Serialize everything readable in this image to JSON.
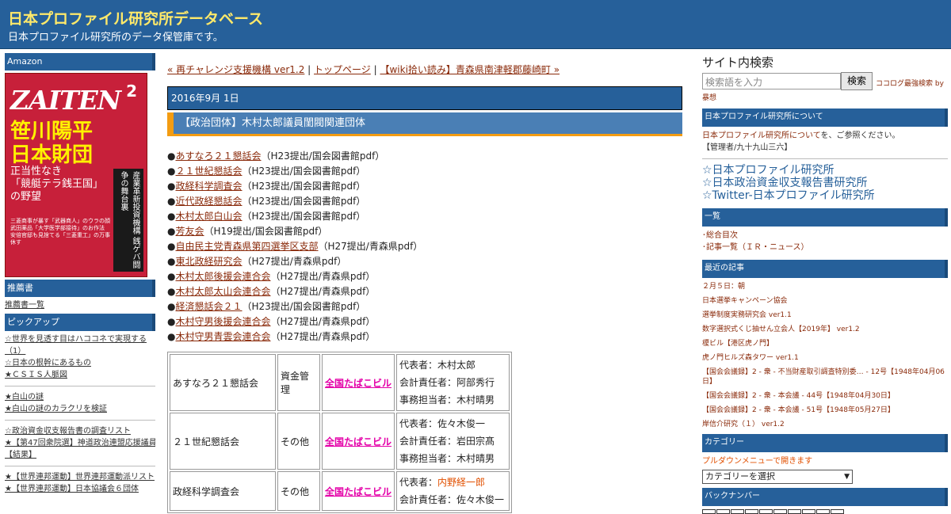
{
  "header": {
    "title": "日本プロファイル研究所データベース",
    "description": "日本プロファイル研究所のデータ保管庫です。"
  },
  "left": {
    "amazon_head": "Amazon",
    "magazine": {
      "logo": "ZAITEN",
      "issue": "2",
      "headline1": "笹川陽平",
      "headline2": "日本財団",
      "subline1": "正当性なき",
      "subline2": "「競艇テラ銭王国」",
      "subline3": "の野望",
      "side": "産業革新投資機構 銭ゲバ闘争の舞台裏",
      "small": "三菱商事が暴す「武器商人」のウラの顔 武田薬品「大学医学部接待」のお作法 安倍官邸も見捨てる「三菱重工」の万事休す"
    },
    "recommend_head": "推薦書",
    "recommend_link": "推薦書一覧",
    "pickup_head": "ピックアップ",
    "pickups_a": [
      "☆世界を見透す目はハココネで実現する",
      "（1）",
      "☆日本の根幹にあるもの",
      "★ＣＳＩＳ人脈図"
    ],
    "pickups_b": [
      "★白山の謎",
      "★白山の謎のカラクリを検証"
    ],
    "pickups_c": [
      "☆政治資金収支報告書の調査リスト",
      "★【第47回衆院選】神道政治連盟応援議員",
      "【結果】"
    ],
    "pickups_d": [
      "★【世界連邦運動】世界連邦運動派リスト",
      "★【世界連邦運動】日本協議会６団体"
    ]
  },
  "main": {
    "nav_prev": "« 再チャレンジ支援機構 ver1.2",
    "nav_sep1": " | ",
    "nav_top": "トップページ",
    "nav_sep2": " | ",
    "nav_next": "【wiki拾い読み】青森県南津軽郡藤崎町 »",
    "date": "2016年9月 1日",
    "post_title": "【政治団体】木村太郎議員閨閥関連団体",
    "posts": [
      {
        "name": "あすなろ２１懇話会",
        "note": "（H23提出/国会図書館pdf）"
      },
      {
        "name": "２１世紀懇話会",
        "note": "（H23提出/国会図書館pdf）"
      },
      {
        "name": "政経科学調査会",
        "note": "（H23提出/国会図書館pdf）"
      },
      {
        "name": "近代政経懇話会",
        "note": "（H23提出/国会図書館pdf）"
      },
      {
        "name": "木村太郎白山会",
        "note": "（H23提出/国会図書館pdf）"
      },
      {
        "name": "芳友会",
        "note": "（H19提出/国会図書館pdf）"
      },
      {
        "name": "自由民主党青森県第四選挙区支部",
        "note": "（H27提出/青森県pdf）"
      },
      {
        "name": "東北政経研究会",
        "note": "（H27提出/青森県pdf）"
      },
      {
        "name": "木村太郎後援会連合会",
        "note": "（H27提出/青森県pdf）"
      },
      {
        "name": "木村太郎太山会連合会",
        "note": "（H27提出/青森県pdf）"
      },
      {
        "name": "経済懇話会２１",
        "note": "（H23提出/国会図書館pdf）"
      },
      {
        "name": "木村守男後援会連合会",
        "note": "（H27提出/青森県pdf）"
      },
      {
        "name": "木村守男青雲会連合会",
        "note": "（H27提出/青森県pdf）"
      }
    ],
    "table": [
      {
        "org": "あすなろ２１懇話会",
        "type": "資金管理",
        "addr": "全国たばこビル",
        "rep": "代表者：木村太郎",
        "acct": "会計責任者：阿部秀行",
        "admin": "事務担当者：木村晴男"
      },
      {
        "org": "２１世紀懇話会",
        "type": "その他",
        "addr": "全国たばこビル",
        "rep": "代表者：佐々木俊一",
        "acct": "会計責任者：岩田宗髙",
        "admin": "事務担当者：木村晴男"
      },
      {
        "org": "政経科学調査会",
        "type": "その他",
        "addr": "全国たばこビル",
        "rep_label": "代表者：",
        "rep_name": "内野経一郎",
        "acct": "会計責任者：佐々木俊一"
      }
    ]
  },
  "right": {
    "search_title": "サイト内検索",
    "search_placeholder": "検索語を入力",
    "search_button": "検索",
    "cocolog": "ココログ最強検索 by",
    "mousou": "暴想",
    "about_head": "日本プロファイル研究所について",
    "about_link": "日本プロファイル研究所について",
    "about_text": "を、ご参照ください。",
    "admin": "【管理者/九十九山三六】",
    "links": [
      "☆日本プロファイル研究所",
      "☆日本政治資金収支報告書研究所",
      "☆Twitter-日本プロファイル研究所"
    ],
    "list_head": "一覧",
    "list_items": [
      "総合目次",
      "記事一覧（ＩＲ・ニュース）"
    ],
    "recent_head": "最近の記事",
    "recent": [
      "２月５日：朝",
      "日本選挙キャンペーン協会",
      "選挙制度実務研究会 ver1.1",
      "数字選択式くじ抽せん立会人【2019年】 ver1.2",
      "榎ビル【港区虎ノ門】",
      "虎ノ門ヒルズ森タワー ver1.1"
    ],
    "recent_long": "【国会会議録】2 - 衆 - 不当財産取引調査特別委… - 12号【1948年04月06日】",
    "recent_tail": [
      "【国会会議録】2 - 衆 - 本会議 - 44号【1948年04月30日】",
      "【国会会議録】2 - 衆 - 本会議 - 51号【1948年05月27日】",
      "岸信介研究（１） ver1.2"
    ],
    "category_head": "カテゴリー",
    "category_note": "プルダウンメニューで開きます",
    "category_select": "カテゴリーを選択",
    "backnumber_head": "バックナンバー"
  },
  "colors": {
    "header_bg": "#26609a",
    "title": "#ffe96a",
    "accent": "#f39c12",
    "link": "#8a2a0a",
    "table_link": "#e400a8"
  }
}
